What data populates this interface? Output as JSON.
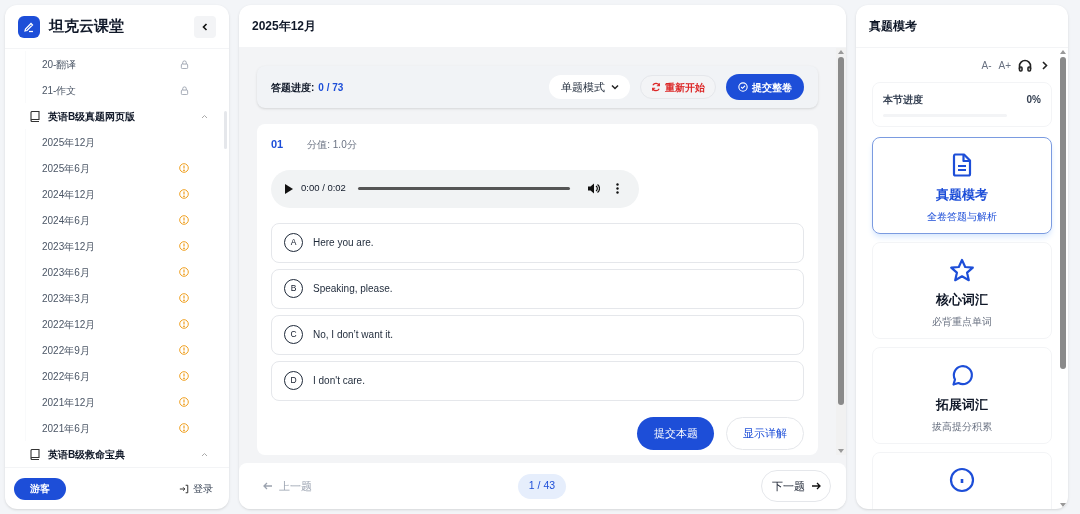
{
  "sidebar": {
    "brand": "坦克云课堂",
    "items": [
      {
        "kind": "locked",
        "label": "20-翻译"
      },
      {
        "kind": "locked",
        "label": "21-作文"
      },
      {
        "kind": "section",
        "label": "英语B级真题网页版",
        "expanded": true,
        "children": [
          {
            "kind": "plain",
            "label": "2025年12月"
          },
          {
            "kind": "alert",
            "label": "2025年6月"
          },
          {
            "kind": "alert",
            "label": "2024年12月"
          },
          {
            "kind": "alert",
            "label": "2024年6月"
          },
          {
            "kind": "alert",
            "label": "2023年12月"
          },
          {
            "kind": "alert",
            "label": "2023年6月"
          },
          {
            "kind": "alert",
            "label": "2023年3月"
          },
          {
            "kind": "alert",
            "label": "2022年12月"
          },
          {
            "kind": "alert",
            "label": "2022年9月"
          },
          {
            "kind": "alert",
            "label": "2022年6月"
          },
          {
            "kind": "alert",
            "label": "2021年12月"
          },
          {
            "kind": "alert",
            "label": "2021年6月"
          }
        ]
      },
      {
        "kind": "section",
        "label": "英语B级救命宝典",
        "expanded": true
      }
    ],
    "guest_button": "游客",
    "login_link": "登录"
  },
  "main": {
    "title": "2025年12月",
    "progress_label": "答题进度:",
    "progress_value": "0 / 73",
    "mode_select": "单题模式",
    "restart_button": "重新开始",
    "submit_all_button": "提交整卷",
    "question": {
      "number": "01",
      "score": "分值: 1.0分",
      "audio_time": "0:00 / 0:02",
      "options": [
        {
          "letter": "A",
          "text": "Here you are.",
          "selected": false
        },
        {
          "letter": "B",
          "text": "Speaking, please.",
          "selected": false
        },
        {
          "letter": "C",
          "text": "No, I don’t want it.",
          "selected": false
        },
        {
          "letter": "D",
          "text": "I don't care.",
          "selected": false
        }
      ],
      "submit_button": "提交本题",
      "details_button": "显示详解"
    },
    "prev_button": "上一题",
    "page_indicator": "1 / 43",
    "next_button": "下一题"
  },
  "right_panel": {
    "title": "真题模考",
    "font_smaller": "A-",
    "font_larger": "A+",
    "section_progress": {
      "label": "本节进度",
      "value": "0%",
      "level": 0
    },
    "cards": [
      {
        "kind": "document",
        "title": "真题模考",
        "subtitle": "全卷答题与解析",
        "selected": true
      },
      {
        "kind": "star",
        "title": "核心词汇",
        "subtitle": "必背重点单词",
        "selected": false
      },
      {
        "kind": "chat",
        "title": "拓展词汇",
        "subtitle": "拔高提分积累",
        "selected": false
      },
      {
        "kind": "info",
        "selected": false
      }
    ]
  }
}
